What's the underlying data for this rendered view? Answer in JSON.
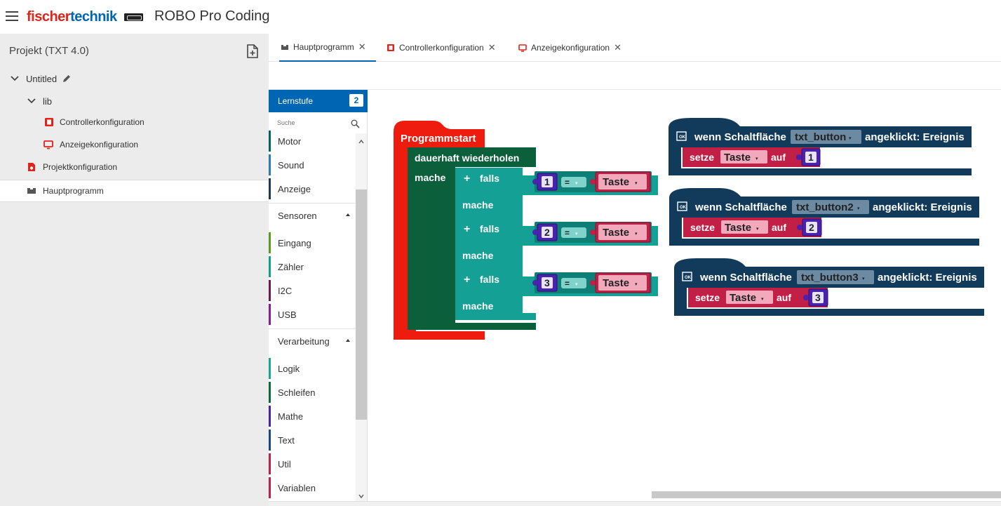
{
  "header": {
    "brand_part1": "fischer",
    "brand_part2": "technik",
    "app_title": "ROBO Pro Coding"
  },
  "sidebar": {
    "project_title": "Projekt (TXT 4.0)",
    "tree": [
      {
        "label": "Untitled",
        "icon": "pencil-icon"
      },
      {
        "label": "lib",
        "icon": "chevron-down-icon"
      },
      {
        "label": "Controllerkonfiguration",
        "icon": "controller-icon"
      },
      {
        "label": "Anzeigekonfiguration",
        "icon": "monitor-icon"
      },
      {
        "label": "Projektkonfiguration",
        "icon": "config-file-icon"
      },
      {
        "label": "Hauptprogramm",
        "icon": "program-icon"
      }
    ]
  },
  "tabs": [
    {
      "label": "Hauptprogramm",
      "active": true
    },
    {
      "label": "Controllerkonfiguration",
      "active": false
    },
    {
      "label": "Anzeigekonfiguration",
      "active": false
    }
  ],
  "toolbox": {
    "level_label": "Lernstufe",
    "level_value": "2",
    "search_placeholder": "Suche",
    "categories_top": [
      {
        "label": "Motor",
        "color": "#00665a"
      },
      {
        "label": "Sound",
        "color": "#2b79b8"
      },
      {
        "label": "Anzeige",
        "color": "#1c3b5a"
      }
    ],
    "group_sensoren": "Sensoren",
    "categories_sensoren": [
      {
        "label": "Eingang",
        "color": "#5e9a1b"
      },
      {
        "label": "Zähler",
        "color": "#12a08a"
      },
      {
        "label": "I2C",
        "color": "#6a1b56"
      },
      {
        "label": "USB",
        "color": "#8a1b9a"
      }
    ],
    "group_verarbeitung": "Verarbeitung",
    "categories_verarbeitung": [
      {
        "label": "Logik",
        "color": "#1aa597"
      },
      {
        "label": "Schleifen",
        "color": "#0b6a3c"
      },
      {
        "label": "Mathe",
        "color": "#4a22b0"
      },
      {
        "label": "Text",
        "color": "#164a7c"
      },
      {
        "label": "Util",
        "color": "#c21f47"
      },
      {
        "label": "Variablen",
        "color": "#c21f47"
      }
    ]
  },
  "blocks": {
    "programmstart": "Programmstart",
    "forever": "dauerhaft wiederholen",
    "mache": "mache",
    "falls": "falls",
    "plus": "+",
    "equals": "=",
    "dropdown_arrow": "▾",
    "variable": "Taste",
    "if_values": [
      "1",
      "2",
      "3"
    ],
    "event_wenn": "wenn Schaltfläche",
    "event_clicked": "angeklickt: Ereignis",
    "event_buttons": [
      "txt_button",
      "txt_button2",
      "txt_button3"
    ],
    "setze": "setze",
    "auf": "auf",
    "set_values": [
      "1",
      "2",
      "3"
    ],
    "colors": {
      "start": "#ed1c0e",
      "loop": "#0b5f3b",
      "logic": "#14a095",
      "math": "#4a22b0",
      "variable": "#c21f47",
      "event": "#123a5b"
    }
  }
}
